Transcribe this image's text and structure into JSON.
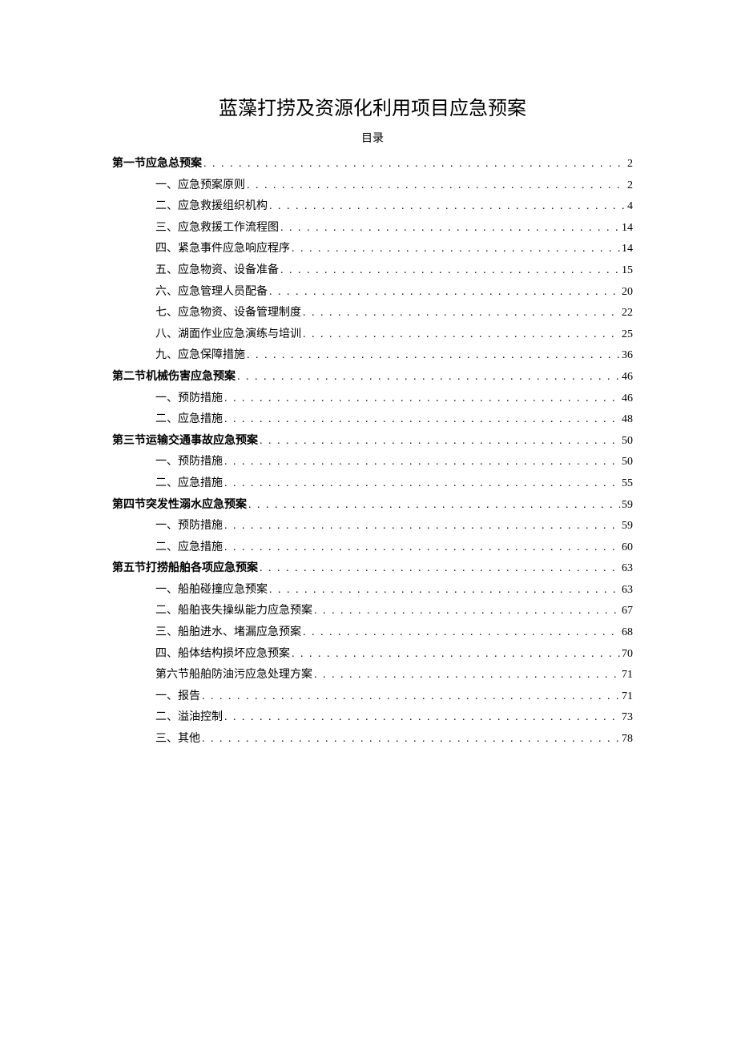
{
  "title": "蓝藻打捞及资源化利用项目应急预案",
  "toc_label": "目录",
  "toc": [
    {
      "level": 0,
      "text": "第一节应急总预案",
      "page": "2"
    },
    {
      "level": 1,
      "text": "一、应急预案原则",
      "page": "2"
    },
    {
      "level": 1,
      "text": "二、应急救援组织机构",
      "page": "4"
    },
    {
      "level": 1,
      "text": "三、应急救援工作流程图",
      "page": "14"
    },
    {
      "level": 1,
      "text": "四、紧急事件应急响应程序",
      "page": "14"
    },
    {
      "level": 1,
      "text": "五、应急物资、设备准备",
      "page": "15"
    },
    {
      "level": 1,
      "text": "六、应急管理人员配备",
      "page": "20"
    },
    {
      "level": 1,
      "text": "七、应急物资、设备管理制度",
      "page": "22"
    },
    {
      "level": 1,
      "text": "八、湖面作业应急演练与培训",
      "page": "25"
    },
    {
      "level": 1,
      "text": "九、应急保障措施",
      "page": "36"
    },
    {
      "level": 0,
      "text": "第二节机械伤害应急预案",
      "page": "46"
    },
    {
      "level": 1,
      "text": "一、预防措施",
      "page": "46"
    },
    {
      "level": 1,
      "text": "二、应急措施",
      "page": "48"
    },
    {
      "level": 0,
      "text": "第三节运输交通事故应急预案",
      "page": "50"
    },
    {
      "level": 1,
      "text": "一、预防措施",
      "page": "50"
    },
    {
      "level": 1,
      "text": "二、应急措施",
      "page": "55"
    },
    {
      "level": 0,
      "text": "第四节突发性溺水应急预案",
      "page": "59"
    },
    {
      "level": 1,
      "text": "一、预防措施",
      "page": "59"
    },
    {
      "level": 1,
      "text": "二、应急措施",
      "page": "60"
    },
    {
      "level": 0,
      "text": "第五节打捞船舶各项应急预案",
      "page": "63"
    },
    {
      "level": 1,
      "text": "一、船舶碰撞应急预案",
      "page": "63"
    },
    {
      "level": 1,
      "text": "二、船舶丧失操纵能力应急预案",
      "page": "67"
    },
    {
      "level": 1,
      "text": "三、船舶进水、堵漏应急预案",
      "page": "68"
    },
    {
      "level": 1,
      "text": "四、船体结构损坏应急预案",
      "page": "70"
    },
    {
      "level": 1,
      "text": "第六节船舶防油污应急处理方案",
      "page": "71"
    },
    {
      "level": 1,
      "text": "一、报告",
      "page": "71"
    },
    {
      "level": 1,
      "text": "二、溢油控制",
      "page": "73"
    },
    {
      "level": 1,
      "text": "三、其他",
      "page": "78"
    }
  ]
}
